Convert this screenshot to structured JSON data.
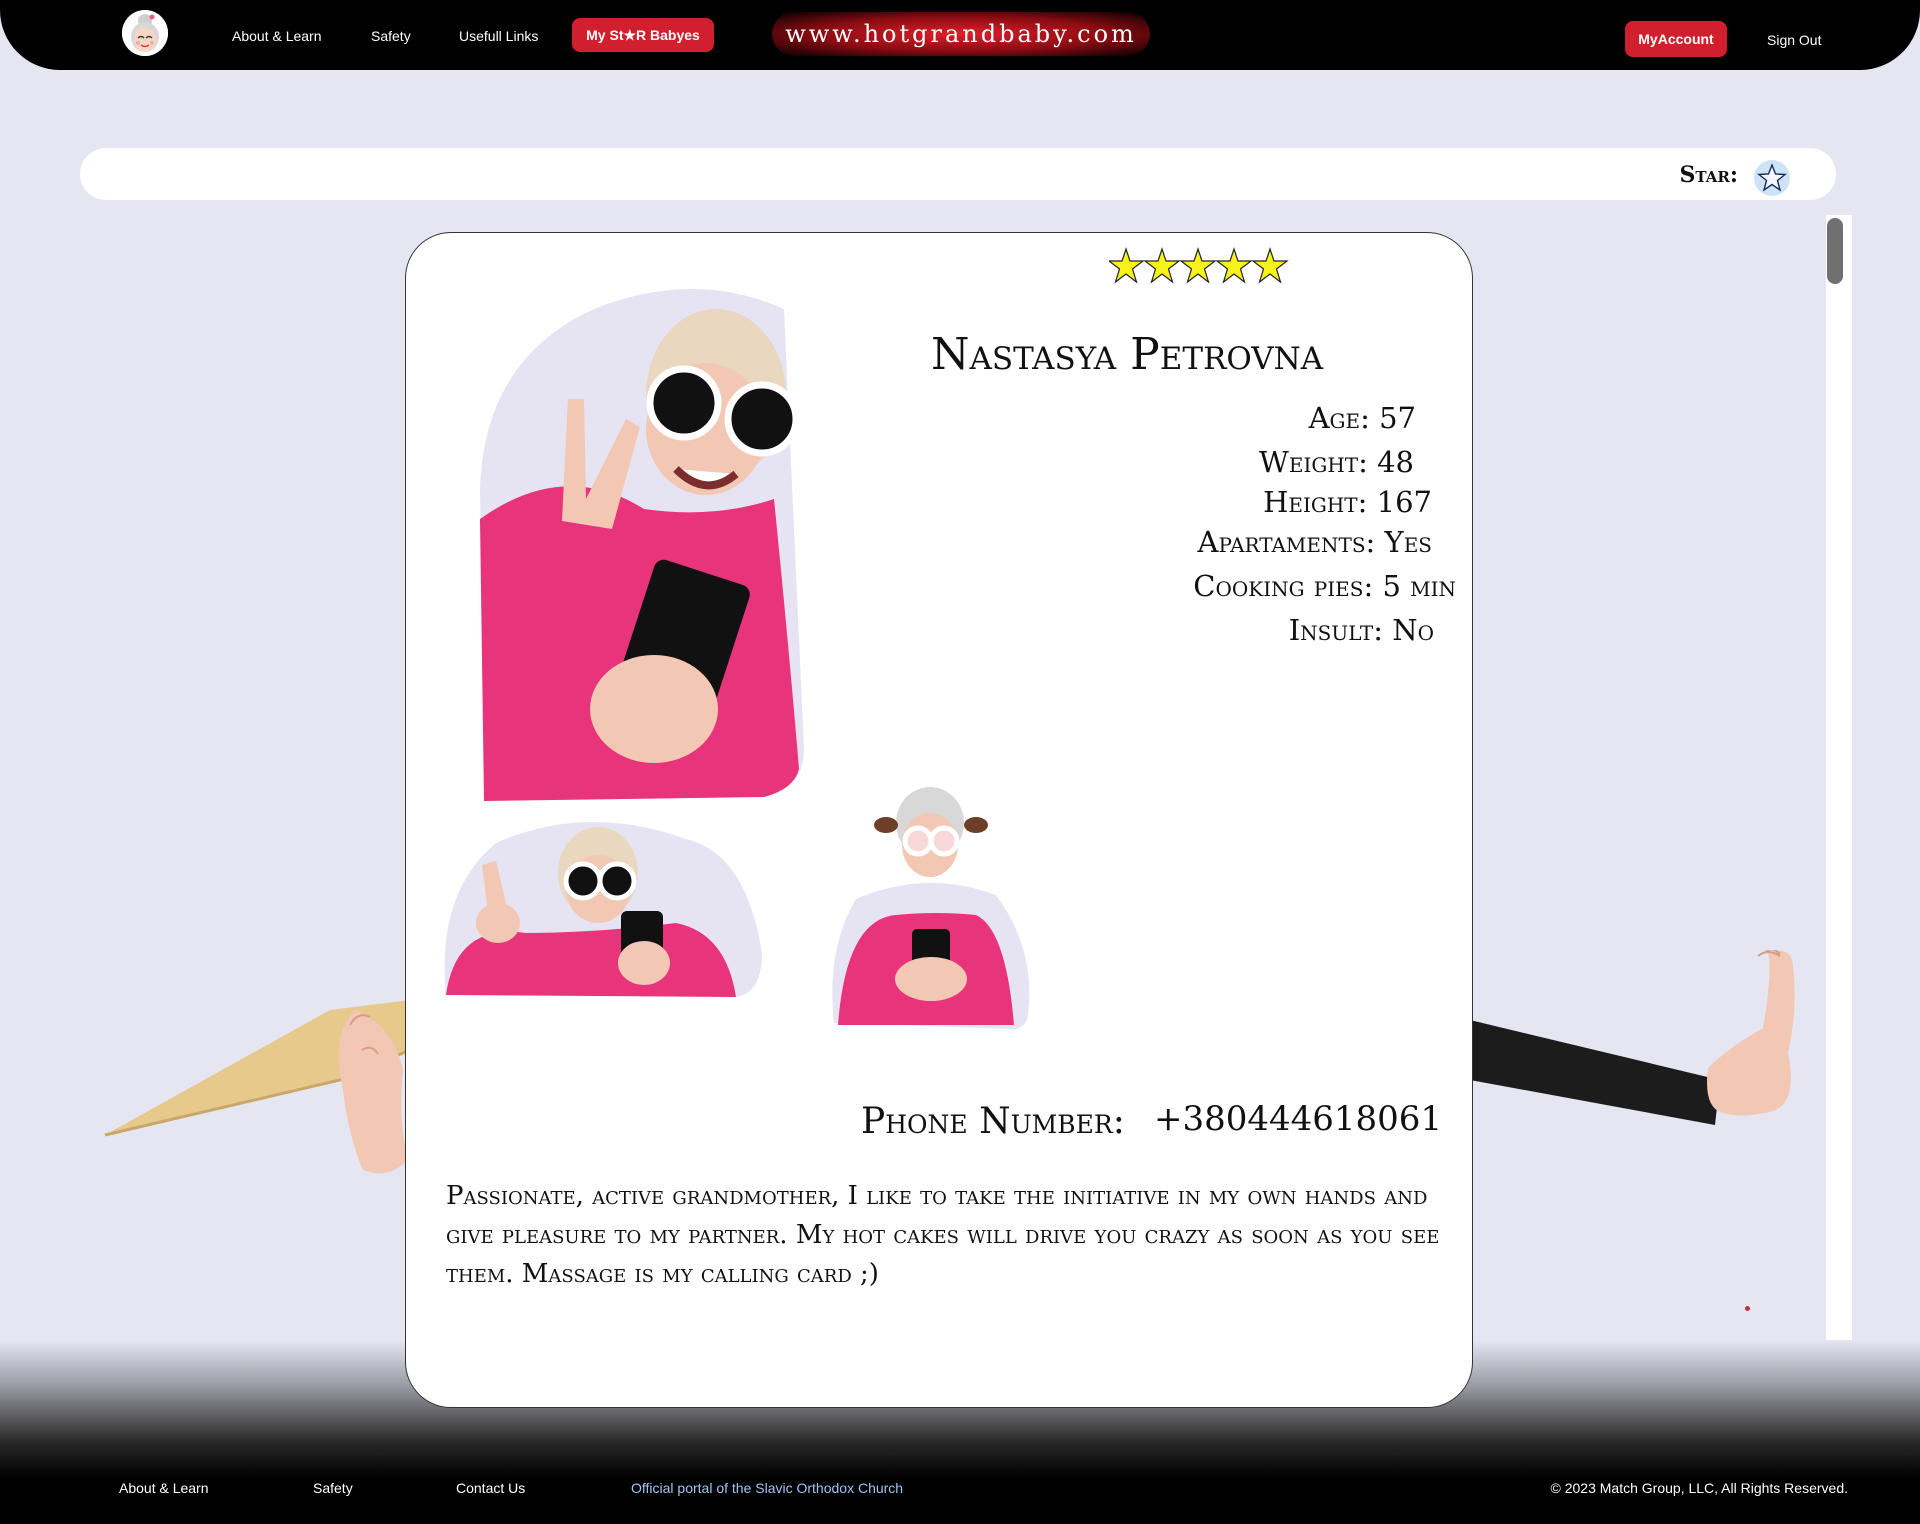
{
  "nav": {
    "about": "About & Learn",
    "safety": "Safety",
    "links": "Usefull Links",
    "stars_button": "My St★R Babyes",
    "site_url": "www.hotgrandbaby.com",
    "account_button": "MyAccount",
    "sign_out": "Sign Out"
  },
  "filter": {
    "label": "Star:",
    "star_icon": "star-outline-icon"
  },
  "profile": {
    "rating_stars": 5,
    "name": "Nastasya Petrovna",
    "attributes": [
      {
        "label": "Age:",
        "value": "57"
      },
      {
        "label": "Weight:",
        "value": "48"
      },
      {
        "label": "Height:",
        "value": "167"
      },
      {
        "label": "Apartaments:",
        "value": "Yes"
      },
      {
        "label": "Cooking pies:",
        "value": "5 min"
      },
      {
        "label": "Insult:",
        "value": "No"
      }
    ],
    "phone_label": "Phone Number:",
    "phone_value": "+380444618061",
    "bio": "Passionate, active grandmother, I like to take the initiative in my own hands and give pleasure to my partner. My hot cakes will drive you crazy as soon as you see them. Massage is my calling card ;)"
  },
  "footer": {
    "about": "About & Learn",
    "safety": "Safety",
    "contact": "Contact Us",
    "portal": "Official portal of the Slavic Orthodox Church",
    "copyright": "© 2023 Match Group, LLC, All Rights Reserved."
  },
  "colors": {
    "accent_red": "#d21f2e",
    "background": "#e6e6f3",
    "rating_star": "#f7f21a",
    "sweater_pink": "#e8347a",
    "portal_link": "#9fc4f5"
  }
}
